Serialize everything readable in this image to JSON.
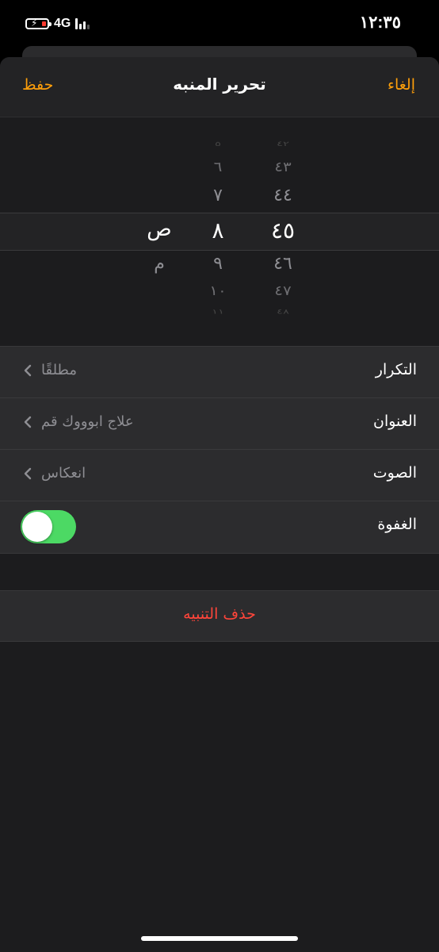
{
  "status": {
    "network": "4G",
    "time": "١٢:٣٥"
  },
  "nav": {
    "left": "حفظ",
    "title": "تحرير المنبه",
    "right": "إلغاء"
  },
  "picker": {
    "minutes": [
      "٤٢",
      "٤٣",
      "٤٤",
      "٤٥",
      "٤٦",
      "٤٧",
      "٤٨"
    ],
    "hours": [
      "٥",
      "٦",
      "٧",
      "٨",
      "٩",
      "١٠",
      "١١"
    ],
    "ampm": [
      "ص",
      "م"
    ],
    "selected": {
      "minute": "٤٥",
      "hour": "٨",
      "ampm": "ص"
    }
  },
  "settings": {
    "repeat": {
      "label": "التكرار",
      "value": "مطلقًا"
    },
    "title": {
      "label": "العنوان",
      "value": "علاج ابوووك قم"
    },
    "sound": {
      "label": "الصوت",
      "value": "انعكاس"
    },
    "snooze": {
      "label": "الغفوة",
      "enabled": true
    }
  },
  "delete_label": "حذف التنبيه",
  "colors": {
    "accent": "#ff9f0a",
    "destructive": "#ff453a",
    "toggle_on": "#4cd964"
  },
  "icons": [
    "battery-charging-icon",
    "signal-icon",
    "chevron-left-icon"
  ]
}
